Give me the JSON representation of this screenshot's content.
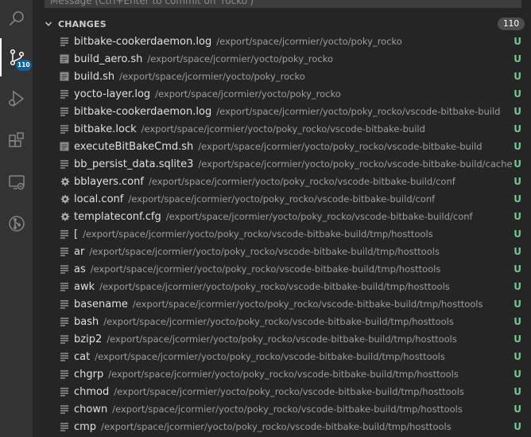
{
  "activity_bar": {
    "icons": [
      "search-icon",
      "source-control-icon",
      "run-debug-icon",
      "extensions-icon",
      "remote-explorer-icon",
      "git-graph-icon"
    ],
    "source_control_badge": "110"
  },
  "commit": {
    "placeholder": "Message (Ctrl+Enter to commit on 'rocko')"
  },
  "changes": {
    "label": "CHANGES",
    "count": "110"
  },
  "colors": {
    "untracked": "#73c991",
    "badge_blue": "#0e639c"
  },
  "files": [
    {
      "name": "bitbake-cookerdaemon.log",
      "path": "/export/space/jcormier/yocto/poky_rocko",
      "icon": "lines-file-icon",
      "status": "U"
    },
    {
      "name": "build_aero.sh",
      "path": "/export/space/jcormier/yocto/poky_rocko",
      "icon": "shell-file-icon",
      "status": "U"
    },
    {
      "name": "build.sh",
      "path": "/export/space/jcormier/yocto/poky_rocko",
      "icon": "shell-file-icon",
      "status": "U"
    },
    {
      "name": "yocto-layer.log",
      "path": "/export/space/jcormier/yocto/poky_rocko",
      "icon": "lines-file-icon",
      "status": "U"
    },
    {
      "name": "bitbake-cookerdaemon.log",
      "path": "/export/space/jcormier/yocto/poky_rocko/vscode-bitbake-build",
      "icon": "lines-file-icon",
      "status": "U"
    },
    {
      "name": "bitbake.lock",
      "path": "/export/space/jcormier/yocto/poky_rocko/vscode-bitbake-build",
      "icon": "lines-file-icon",
      "status": "U"
    },
    {
      "name": "executeBitBakeCmd.sh",
      "path": "/export/space/jcormier/yocto/poky_rocko/vscode-bitbake-build",
      "icon": "shell-file-icon",
      "status": "U"
    },
    {
      "name": "bb_persist_data.sqlite3",
      "path": "/export/space/jcormier/yocto/poky_rocko/vscode-bitbake-build/cache",
      "icon": "lines-file-icon",
      "status": "U"
    },
    {
      "name": "bblayers.conf",
      "path": "/export/space/jcormier/yocto/poky_rocko/vscode-bitbake-build/conf",
      "icon": "gear-file-icon",
      "status": "U"
    },
    {
      "name": "local.conf",
      "path": "/export/space/jcormier/yocto/poky_rocko/vscode-bitbake-build/conf",
      "icon": "gear-file-icon",
      "status": "U"
    },
    {
      "name": "templateconf.cfg",
      "path": "/export/space/jcormier/yocto/poky_rocko/vscode-bitbake-build/conf",
      "icon": "gear-file-icon",
      "status": "U"
    },
    {
      "name": "[",
      "path": "/export/space/jcormier/yocto/poky_rocko/vscode-bitbake-build/tmp/hosttools",
      "icon": "lines-file-icon",
      "status": "U"
    },
    {
      "name": "ar",
      "path": "/export/space/jcormier/yocto/poky_rocko/vscode-bitbake-build/tmp/hosttools",
      "icon": "lines-file-icon",
      "status": "U"
    },
    {
      "name": "as",
      "path": "/export/space/jcormier/yocto/poky_rocko/vscode-bitbake-build/tmp/hosttools",
      "icon": "lines-file-icon",
      "status": "U"
    },
    {
      "name": "awk",
      "path": "/export/space/jcormier/yocto/poky_rocko/vscode-bitbake-build/tmp/hosttools",
      "icon": "lines-file-icon",
      "status": "U"
    },
    {
      "name": "basename",
      "path": "/export/space/jcormier/yocto/poky_rocko/vscode-bitbake-build/tmp/hosttools",
      "icon": "lines-file-icon",
      "status": "U"
    },
    {
      "name": "bash",
      "path": "/export/space/jcormier/yocto/poky_rocko/vscode-bitbake-build/tmp/hosttools",
      "icon": "lines-file-icon",
      "status": "U"
    },
    {
      "name": "bzip2",
      "path": "/export/space/jcormier/yocto/poky_rocko/vscode-bitbake-build/tmp/hosttools",
      "icon": "lines-file-icon",
      "status": "U"
    },
    {
      "name": "cat",
      "path": "/export/space/jcormier/yocto/poky_rocko/vscode-bitbake-build/tmp/hosttools",
      "icon": "lines-file-icon",
      "status": "U"
    },
    {
      "name": "chgrp",
      "path": "/export/space/jcormier/yocto/poky_rocko/vscode-bitbake-build/tmp/hosttools",
      "icon": "lines-file-icon",
      "status": "U"
    },
    {
      "name": "chmod",
      "path": "/export/space/jcormier/yocto/poky_rocko/vscode-bitbake-build/tmp/hosttools",
      "icon": "lines-file-icon",
      "status": "U"
    },
    {
      "name": "chown",
      "path": "/export/space/jcormier/yocto/poky_rocko/vscode-bitbake-build/tmp/hosttools",
      "icon": "lines-file-icon",
      "status": "U"
    },
    {
      "name": "cmp",
      "path": "/export/space/jcormier/yocto/poky_rocko/vscode-bitbake-build/tmp/hosttools",
      "icon": "lines-file-icon",
      "status": "U"
    }
  ]
}
